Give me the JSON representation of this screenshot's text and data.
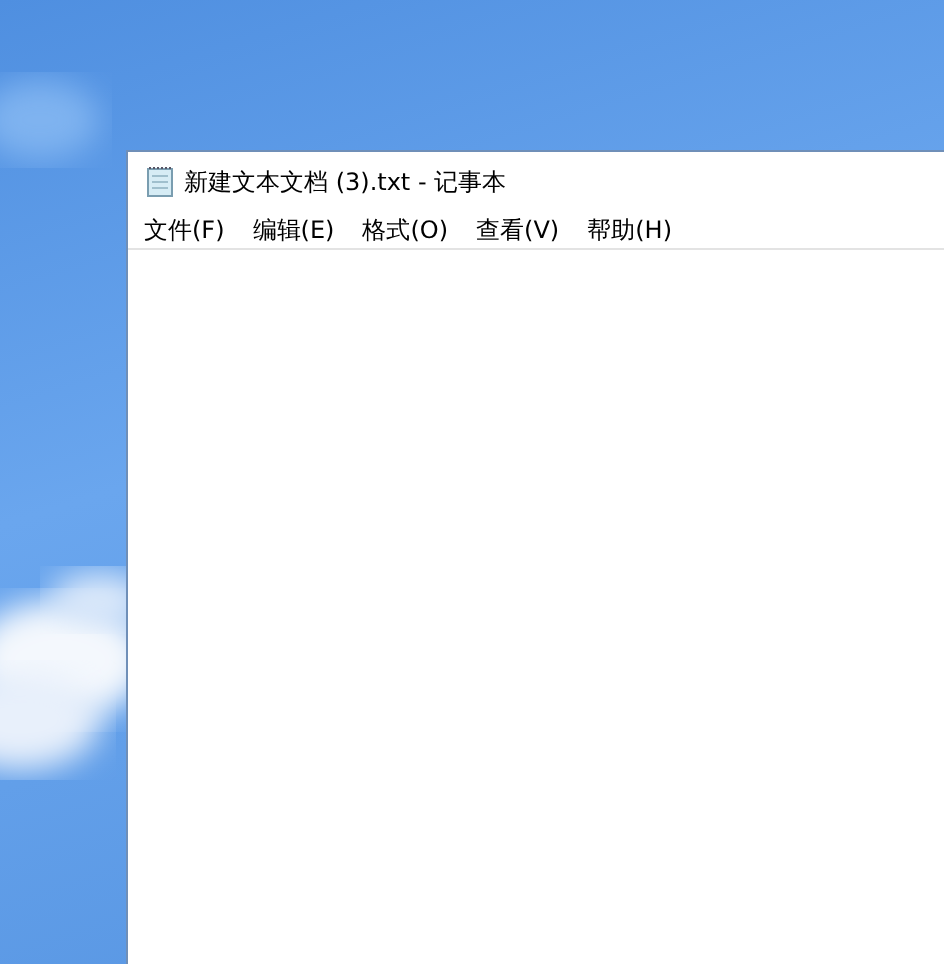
{
  "window": {
    "title": "新建文本文档 (3).txt - 记事本"
  },
  "menu": [
    {
      "label": "文件(F)"
    },
    {
      "label": "编辑(E)"
    },
    {
      "label": "格式(O)"
    },
    {
      "label": "查看(V)"
    },
    {
      "label": "帮助(H)"
    }
  ]
}
